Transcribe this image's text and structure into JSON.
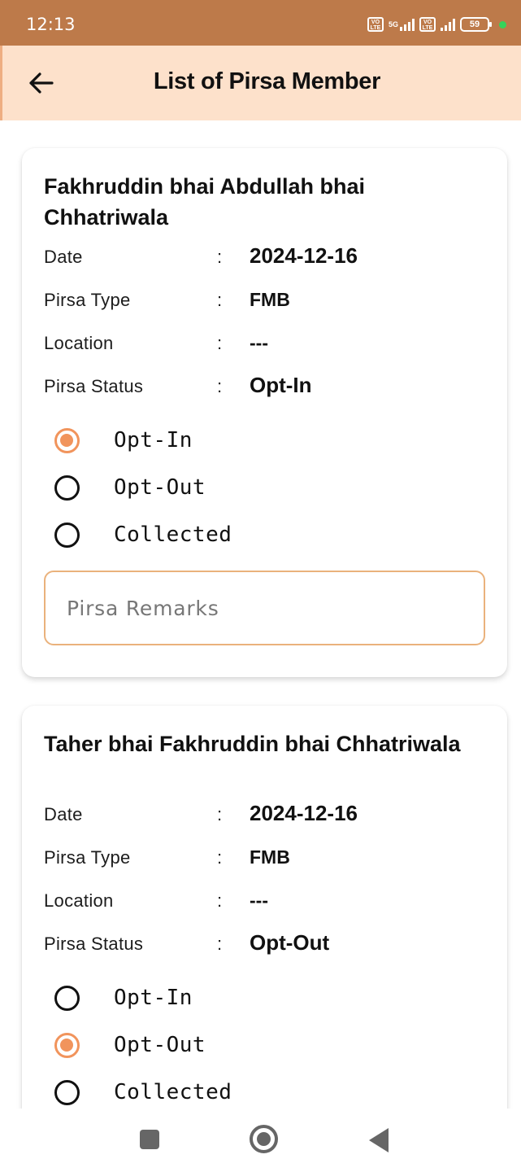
{
  "status_bar": {
    "time": "12:13",
    "network": "5G",
    "battery": "59"
  },
  "app_bar": {
    "title": "List of Pirsa Member"
  },
  "labels": {
    "date": "Date",
    "pirsa_type": "Pirsa Type",
    "location": "Location",
    "pirsa_status": "Pirsa Status",
    "colon": ":",
    "remarks_placeholder": "Pirsa Remarks"
  },
  "options": [
    "Opt-In",
    "Opt-Out",
    "Collected"
  ],
  "members": [
    {
      "name": "Fakhruddin bhai  Abdullah bhai Chhatriwala",
      "date": "2024-12-16",
      "pirsa_type": "FMB",
      "location": "---",
      "pirsa_status": "Opt-In",
      "selected_option": "Opt-In"
    },
    {
      "name": "Taher bhai Fakhruddin bhai Chhatriwala",
      "date": "2024-12-16",
      "pirsa_type": "FMB",
      "location": "---",
      "pirsa_status": "Opt-Out",
      "selected_option": "Opt-Out"
    }
  ],
  "colors": {
    "accent": "#f1945c",
    "app_bar": "#fde1cb",
    "status_bar": "#bd7a4a",
    "input_border": "#eab27c"
  },
  "icons": {
    "back": "arrow-left-icon",
    "nav_recents": "square-icon",
    "nav_home": "circle-icon",
    "nav_back": "triangle-back-icon"
  }
}
